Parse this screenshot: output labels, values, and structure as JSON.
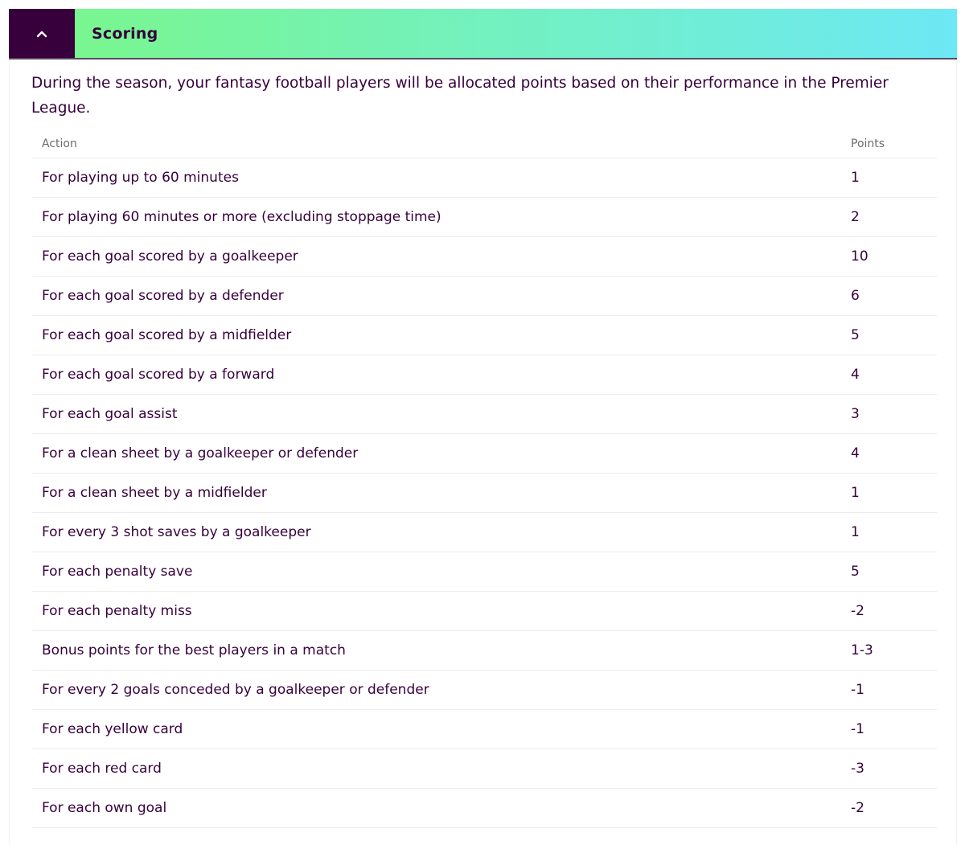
{
  "section": {
    "title": "Scoring",
    "toggle_icon": "chevron-up-icon",
    "expanded": true,
    "colors": {
      "toggle_bg": "#37003c",
      "gradient_start": "#79f68f",
      "gradient_end": "#6de8f5",
      "text": "#37003c"
    }
  },
  "intro": "During the season, your fantasy football players will be allocated points based on their performance in the Premier League.",
  "table": {
    "headers": {
      "action": "Action",
      "points": "Points"
    },
    "rows": [
      {
        "action": "For playing up to 60 minutes",
        "points": "1"
      },
      {
        "action": "For playing 60 minutes or more (excluding stoppage time)",
        "points": "2"
      },
      {
        "action": "For each goal scored by a goalkeeper",
        "points": "10"
      },
      {
        "action": "For each goal scored by a defender",
        "points": "6"
      },
      {
        "action": "For each goal scored by a midfielder",
        "points": "5"
      },
      {
        "action": "For each goal scored by a forward",
        "points": "4"
      },
      {
        "action": "For each goal assist",
        "points": "3"
      },
      {
        "action": "For a clean sheet by a goalkeeper or defender",
        "points": "4"
      },
      {
        "action": "For a clean sheet by a midfielder",
        "points": "1"
      },
      {
        "action": "For every 3 shot saves by a goalkeeper",
        "points": "1"
      },
      {
        "action": "For each penalty save",
        "points": "5"
      },
      {
        "action": "For each penalty miss",
        "points": "-2"
      },
      {
        "action": "Bonus points for the best players in a match",
        "points": "1-3"
      },
      {
        "action": "For every 2 goals conceded by a goalkeeper or defender",
        "points": "-1"
      },
      {
        "action": "For each yellow card",
        "points": "-1"
      },
      {
        "action": "For each red card",
        "points": "-3"
      },
      {
        "action": "For each own goal",
        "points": "-2"
      }
    ]
  }
}
